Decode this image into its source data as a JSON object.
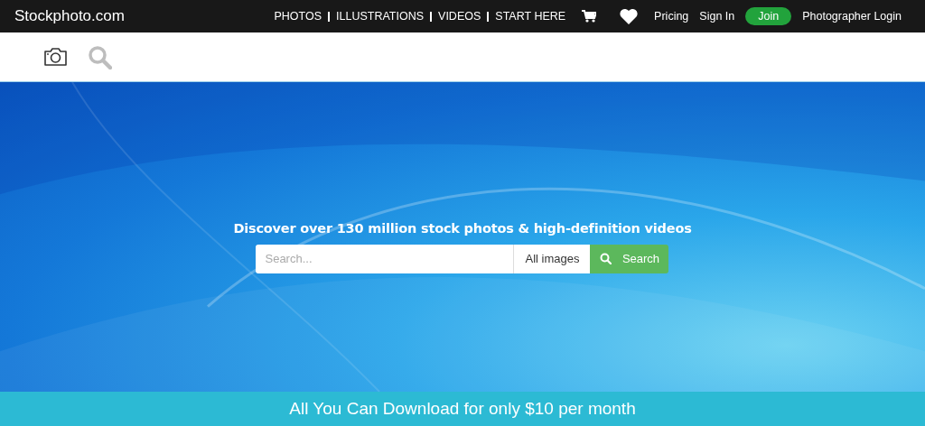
{
  "header": {
    "logo": "Stockphoto.com",
    "nav": [
      {
        "label": "PHOTOS"
      },
      {
        "label": "ILLUSTRATIONS"
      },
      {
        "label": "VIDEOS"
      },
      {
        "label": "START HERE"
      }
    ],
    "links": [
      {
        "label": "Pricing",
        "kind": "link"
      },
      {
        "label": "Sign In",
        "kind": "link"
      },
      {
        "label": "Join",
        "kind": "pill"
      },
      {
        "label": "Photographer Login",
        "kind": "link"
      }
    ]
  },
  "hero": {
    "headline": "Discover over 130 million stock photos & high-definition videos",
    "search": {
      "placeholder": "Search...",
      "category": "All images",
      "button": "Search"
    }
  },
  "banner": "All You Can Download for only $10 per month"
}
